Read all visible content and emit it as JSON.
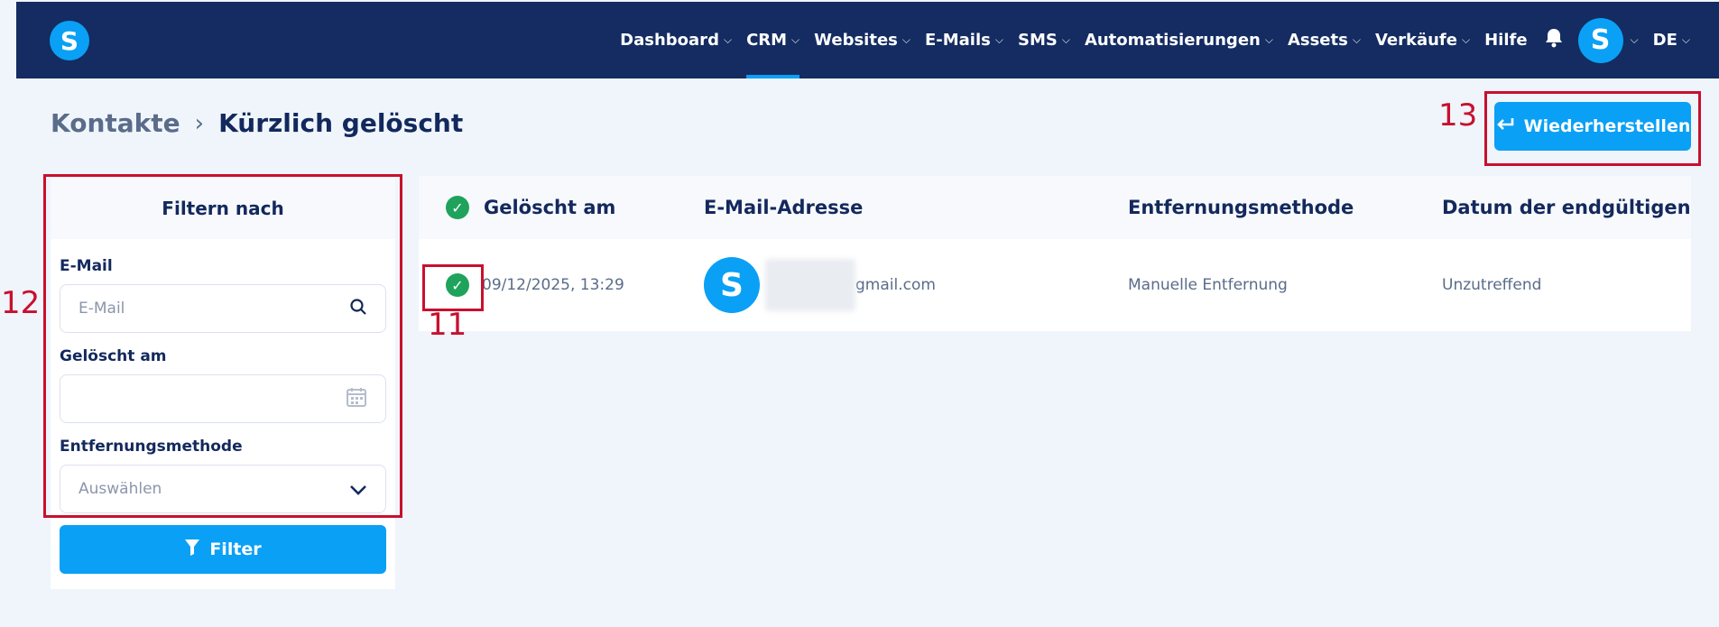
{
  "nav": {
    "logo": "S",
    "items": [
      {
        "label": "Dashboard",
        "chevron": true,
        "active": false
      },
      {
        "label": "CRM",
        "chevron": true,
        "active": true
      },
      {
        "label": "Websites",
        "chevron": true,
        "active": false
      },
      {
        "label": "E-Mails",
        "chevron": true,
        "active": false
      },
      {
        "label": "SMS",
        "chevron": true,
        "active": false
      },
      {
        "label": "Automatisierungen",
        "chevron": true,
        "active": false
      },
      {
        "label": "Assets",
        "chevron": true,
        "active": false
      },
      {
        "label": "Verkäufe",
        "chevron": true,
        "active": false
      },
      {
        "label": "Hilfe",
        "chevron": false,
        "active": false
      }
    ],
    "avatar": "S",
    "language": "DE"
  },
  "breadcrumb": {
    "parent": "Kontakte",
    "separator": "›",
    "current": "Kürzlich gelöscht"
  },
  "restore_button": {
    "label": "Wiederherstellen"
  },
  "annotations": {
    "a11": "11",
    "a12": "12",
    "a13": "13"
  },
  "filter": {
    "title": "Filtern nach",
    "email": {
      "label": "E-Mail",
      "placeholder": "E-Mail"
    },
    "deleted_at": {
      "label": "Gelöscht am",
      "placeholder": ""
    },
    "method": {
      "label": "Entfernungsmethode",
      "placeholder": "Auswählen"
    },
    "button": "Filter"
  },
  "table": {
    "headers": [
      "Gelöscht am",
      "E-Mail-Adresse",
      "Entfernungsmethode",
      "Datum der endgültigen Lö"
    ],
    "rows": [
      {
        "deleted_at": "09/12/2025, 13:29",
        "avatar": "S",
        "email": "gmail.com",
        "method": "Manuelle Entfernung",
        "final_date": "Unzutreffend"
      }
    ]
  },
  "colors": {
    "accent": "#0aa0f5",
    "nav_bg": "#142c61",
    "success": "#1fa35c",
    "annotation": "#c8102e"
  }
}
